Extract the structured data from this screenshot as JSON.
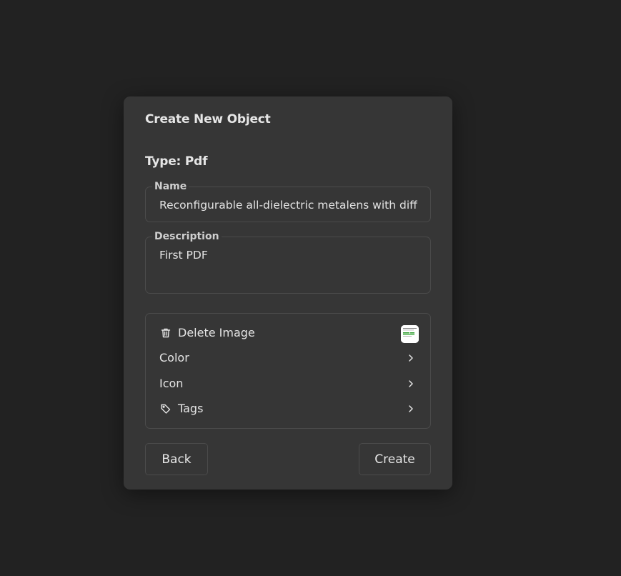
{
  "dialog": {
    "title": "Create New Object",
    "type_label": "Type: Pdf"
  },
  "fields": {
    "name": {
      "label": "Name",
      "value": "Reconfigurable all-dielectric metalens with diffra"
    },
    "description": {
      "label": "Description",
      "value": "First PDF"
    }
  },
  "options": {
    "delete_image": {
      "label": "Delete Image",
      "icon": "trash-icon"
    },
    "color": {
      "label": "Color",
      "icon": "chevron-right-icon"
    },
    "icon": {
      "label": "Icon",
      "icon": "chevron-right-icon"
    },
    "tags": {
      "label": "Tags",
      "icon": "tag-icon"
    }
  },
  "buttons": {
    "back_label": "Back",
    "create_label": "Create"
  },
  "colors": {
    "background": "#222222",
    "panel": "#363636",
    "border": "#4b4b4b",
    "text": "#e6e6e6",
    "thumbnail_accent": "#2e9b2e"
  }
}
